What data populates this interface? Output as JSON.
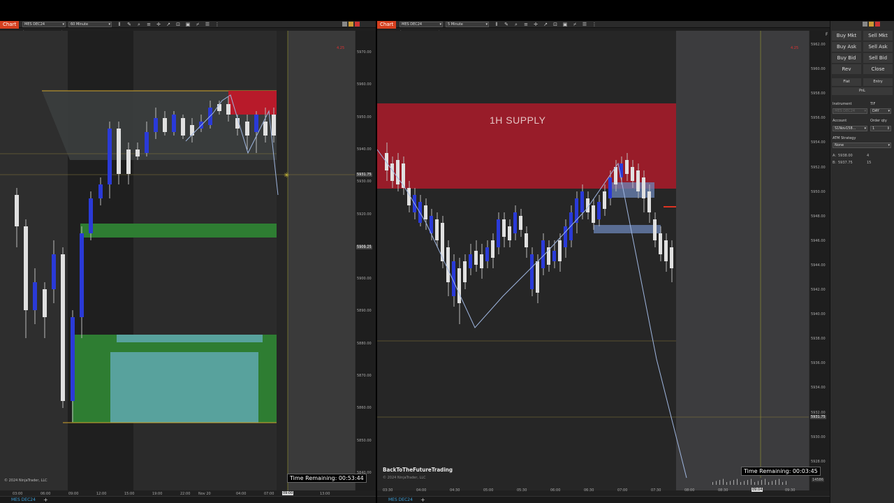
{
  "left_chart": {
    "tab_label": "Chart",
    "instrument": "MES DEC24",
    "interval": "60 Minute",
    "price_labels": [
      "5970.00",
      "5960.00",
      "5950.00",
      "5940.00",
      "5930.00",
      "5920.00",
      "5910.00",
      "5900.00",
      "5890.00",
      "5880.00",
      "5870.00",
      "5860.00",
      "5850.00",
      "5840.00"
    ],
    "last_price": "5931.75",
    "marker_price": "5909.25",
    "time_labels": [
      "03:00",
      "06:00",
      "09:00",
      "12:00",
      "15:00",
      "19:00",
      "22:00",
      "Nov 20",
      "04:00",
      "07:00",
      "13:00"
    ],
    "cursor_time": "09:00",
    "time_remaining": "Time Remaining: 00:53:44",
    "copyright": "© 2024 NinjaTrader, LLC",
    "bottom_tab": "MES DEC24",
    "plus": "+",
    "corner_value": "4.25",
    "colors": {
      "supply": "#b81a2a",
      "demand": "#2e7d32",
      "fvg": "#5fa8b0",
      "bull": "#2a3ad8",
      "bear": "#e0e0e0",
      "line": "#d4a72c"
    }
  },
  "right_chart": {
    "tab_label": "Chart",
    "instrument": "MES DEC24",
    "interval": "5 Minute",
    "zone_label": "1H SUPPLY",
    "price_labels": [
      "5962.00",
      "5960.00",
      "5958.00",
      "5956.00",
      "5954.00",
      "5952.00",
      "5950.00",
      "5948.00",
      "5946.00",
      "5944.00",
      "5942.00",
      "5940.00",
      "5938.00",
      "5936.00",
      "5934.00",
      "5932.00",
      "5930.00",
      "5928.00"
    ],
    "last_price": "5931.75",
    "time_labels": [
      "03:30",
      "04:00",
      "04:30",
      "05:00",
      "05:30",
      "06:00",
      "06:30",
      "07:00",
      "07:30",
      "08:00",
      "08:30",
      "09:00",
      "09:30"
    ],
    "cursor_time": "09:04",
    "volume_label": "14586",
    "time_remaining": "Time Remaining: 00:03:45",
    "watermark": "BackToTheFutureTrading",
    "copyright": "© 2024 NinjaTrader, LLC",
    "bottom_tab": "MES DEC24",
    "plus": "+",
    "corner_value": "4.25"
  },
  "order_panel": {
    "buttons": [
      {
        "label": "Buy Mkt"
      },
      {
        "label": "Sell Mkt"
      },
      {
        "label": "Buy Ask"
      },
      {
        "label": "Sell Ask"
      },
      {
        "label": "Buy Bid"
      },
      {
        "label": "Sell Bid"
      },
      {
        "label": "Rev"
      },
      {
        "label": "Close"
      }
    ],
    "flat": "Flat",
    "entry": "Entry",
    "pnl": "PnL",
    "instrument_label": "Instrument",
    "instrument_value": "MES DEC24",
    "tif_label": "TIF",
    "tif_value": "DAY",
    "account_label": "Account",
    "account_value": "S1Nov158...",
    "qty_label": "Order qty",
    "qty_value": "1",
    "atm_label": "ATM Strategy",
    "atm_value": "None",
    "ask": {
      "label": "A:",
      "price": "5938.00",
      "size": "4"
    },
    "bid": {
      "label": "B:",
      "price": "5937.75",
      "size": "15"
    },
    "side_letter": "F"
  }
}
